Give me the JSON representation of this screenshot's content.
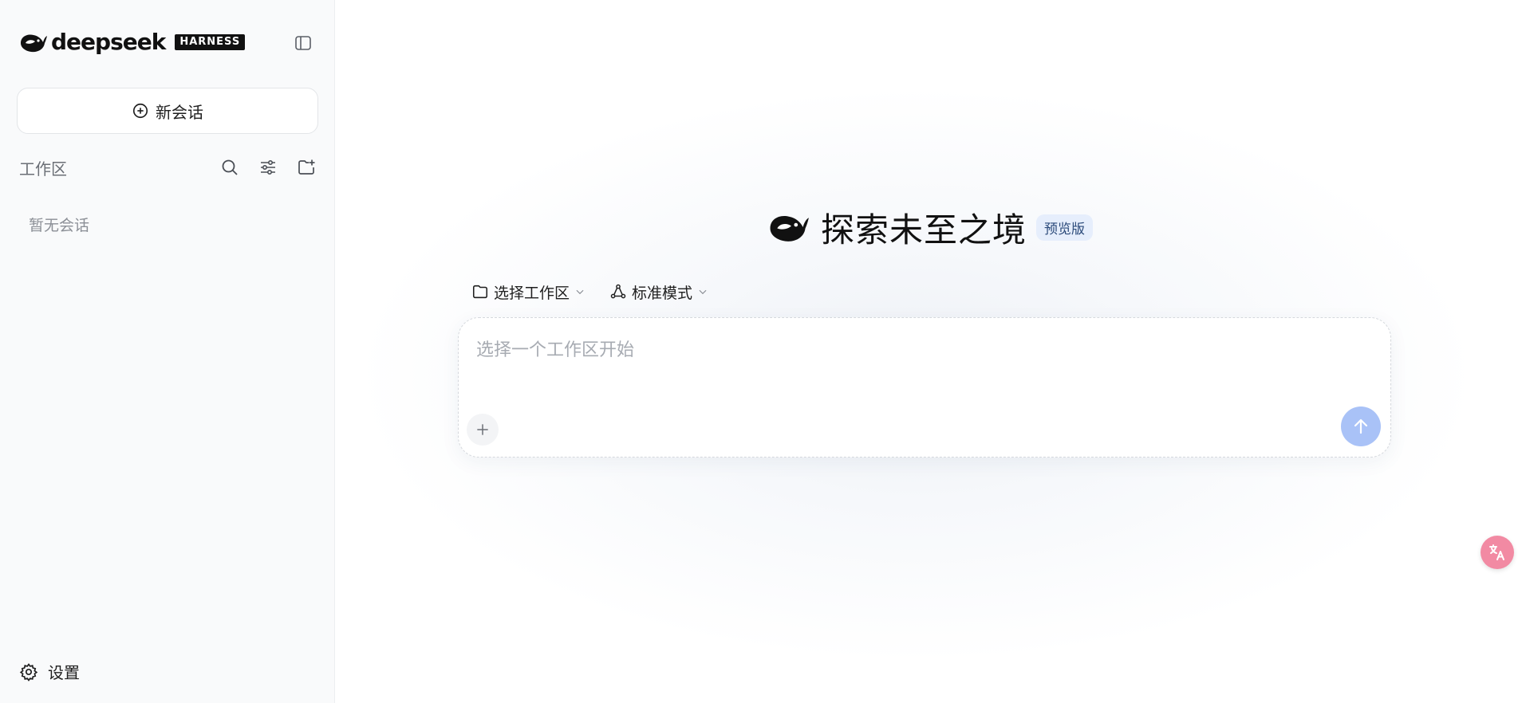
{
  "brand": {
    "wordmark": "deepseek",
    "badge": "HARNESS"
  },
  "sidebar": {
    "new_chat_label": "新会话",
    "workspace_title": "工作区",
    "empty_text": "暂无会话",
    "settings_label": "设置",
    "icons": [
      "sidebar-toggle-icon",
      "plus-circle-icon",
      "search-icon",
      "sliders-icon",
      "folder-plus-icon",
      "gear-icon"
    ]
  },
  "main": {
    "hero_title": "探索未至之境",
    "preview_badge": "预览版",
    "workspace_selector": "选择工作区",
    "mode_selector": "标准模式",
    "input_placeholder": "选择一个工作区开始"
  },
  "colors": {
    "send_button": "#a9c2f7",
    "preview_badge_bg": "#e6eefc",
    "translate_fab": "#f28aa3"
  }
}
